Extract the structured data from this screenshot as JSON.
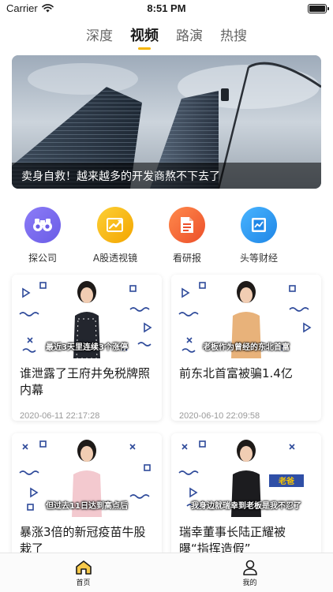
{
  "status_bar": {
    "carrier": "Carrier",
    "time": "8:51 PM",
    "battery": 1.0
  },
  "tabs": [
    {
      "label": "深度",
      "active": false
    },
    {
      "label": "视频",
      "active": true
    },
    {
      "label": "路演",
      "active": false
    },
    {
      "label": "热搜",
      "active": false
    }
  ],
  "banner": {
    "caption": "卖身自救！越来越多的开发商熬不下去了"
  },
  "quick_nav": [
    {
      "label": "探公司",
      "icon": "binoculars-icon",
      "color": "#7a6ff0"
    },
    {
      "label": "A股透视镜",
      "icon": "chart-trend-icon",
      "color": "#f7b500"
    },
    {
      "label": "看研报",
      "icon": "report-document-icon",
      "color": "#f26a3b"
    },
    {
      "label": "头等财经",
      "icon": "finance-chart-icon",
      "color": "#2a9bf0"
    }
  ],
  "videos": [
    {
      "subtitle": "最近3天里连续3个涨停",
      "title": "谁泄露了王府井免税牌照内幕",
      "date": "2020-06-11 22:17:28"
    },
    {
      "subtitle": "老板作为曾经的东北首富",
      "title": "前东北首富被骗1.4亿",
      "date": "2020-06-10 22:09:58"
    },
    {
      "subtitle": "但过去11日达到高点后",
      "title": "暴涨3倍的新冠疫苗牛股栽了",
      "date": ""
    },
    {
      "subtitle": "我身边就瑞幸到老板是我不忍了",
      "badge": "老爸",
      "title": "瑞幸董事长陆正耀被曝“指挥造假”",
      "date": ""
    }
  ],
  "tab_bar": [
    {
      "label": "首页",
      "icon": "home-icon",
      "active": true
    },
    {
      "label": "我的",
      "icon": "user-icon",
      "active": false
    }
  ],
  "colors": {
    "accent": "#f6b400",
    "inactive": "#666666"
  }
}
